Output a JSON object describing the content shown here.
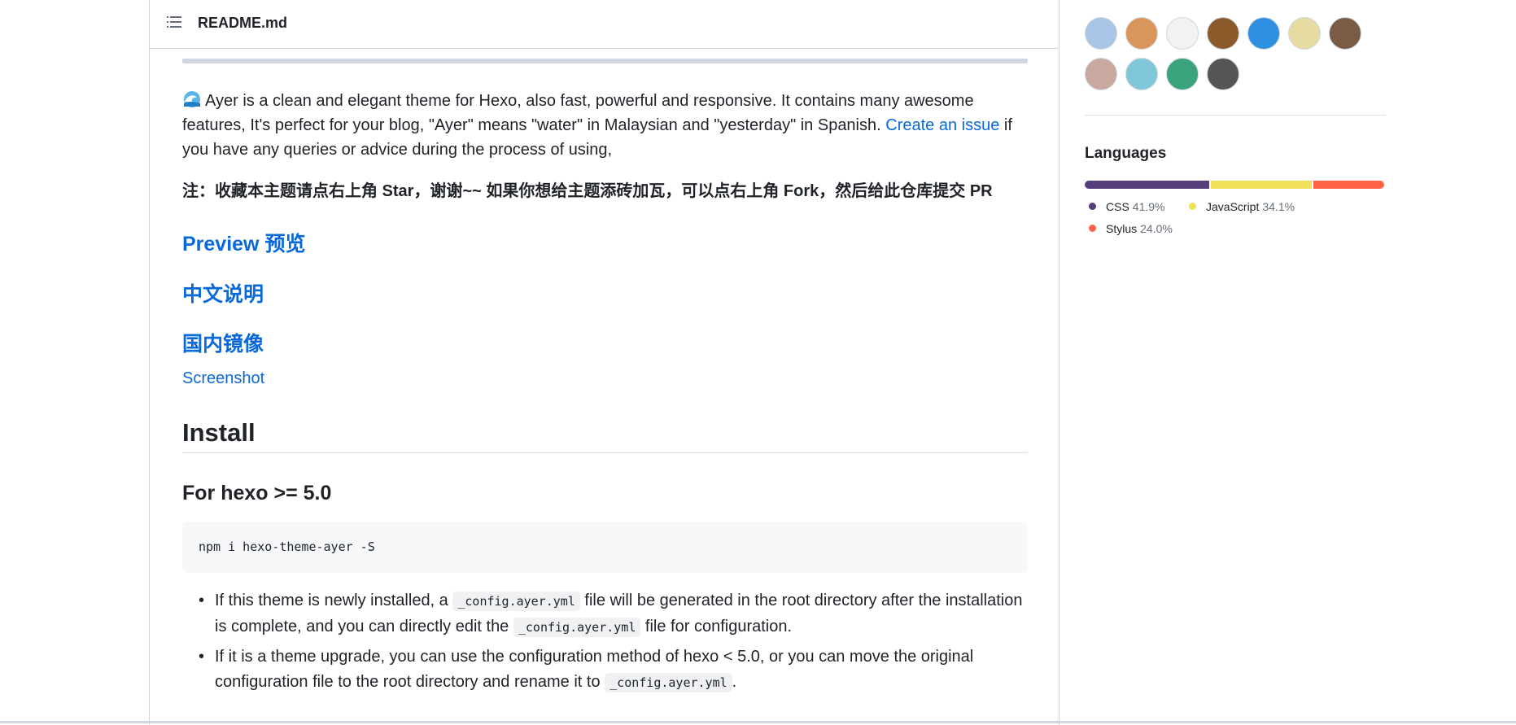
{
  "readme": {
    "title": "README.md",
    "intro_text": "Ayer is a clean and elegant theme for Hexo, also fast, powerful and responsive. It contains many awesome features, It's perfect for your blog, \"Ayer\" means \"water\" in Malaysian and \"yesterday\" in Spanish.",
    "intro_link": "Create an issue",
    "intro_after": " if you have any queries or advice during the process of using,",
    "note": "注：收藏本主题请点右上角 Star，谢谢~~ 如果你想给主题添砖加瓦，可以点右上角 Fork，然后给此仓库提交 PR",
    "link_preview": "Preview 预览",
    "link_chinese": "中文说明",
    "link_mirror": "国内镜像",
    "link_screenshot": "Screenshot",
    "install_heading": "Install",
    "hexo_heading": "For hexo >= 5.0",
    "code": "npm i hexo-theme-ayer -S",
    "bullet1_a": "If this theme is newly installed, a ",
    "bullet1_code1": "_config.ayer.yml",
    "bullet1_b": " file will be generated in the root directory after the installation is complete, and you can directly edit the ",
    "bullet1_code2": "_config.ayer.yml",
    "bullet1_c": " file for configuration.",
    "bullet2_a": "If it is a theme upgrade, you can use the configuration method of hexo < 5.0, or you can move the original configuration file to the root directory and rename it to ",
    "bullet2_code": "_config.ayer.yml",
    "bullet2_b": "."
  },
  "sidebar": {
    "contributors": [
      {
        "name": "contributor-1",
        "color": "#a9c4e4"
      },
      {
        "name": "contributor-2",
        "color": "#d9955a"
      },
      {
        "name": "contributor-3",
        "color": "#f2f2f2"
      },
      {
        "name": "contributor-4",
        "color": "#8a5a2b"
      },
      {
        "name": "contributor-5",
        "color": "#2f8fe0"
      },
      {
        "name": "contributor-6",
        "color": "#e6dba0"
      },
      {
        "name": "contributor-7",
        "color": "#7a5b45"
      },
      {
        "name": "contributor-8",
        "color": "#c9a8a0"
      },
      {
        "name": "contributor-9",
        "color": "#7fc7d9"
      },
      {
        "name": "contributor-10",
        "color": "#3aa37a"
      },
      {
        "name": "contributor-11",
        "color": "#555555"
      }
    ],
    "languages_title": "Languages",
    "languages": [
      {
        "name": "CSS",
        "percent": "41.9%",
        "value": 41.9,
        "color": "#563d7c"
      },
      {
        "name": "JavaScript",
        "percent": "34.1%",
        "value": 34.1,
        "color": "#f1e05a"
      },
      {
        "name": "Stylus",
        "percent": "24.0%",
        "value": 24.0,
        "color": "#ff6347"
      }
    ]
  }
}
